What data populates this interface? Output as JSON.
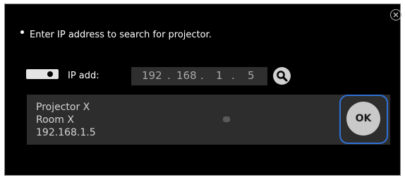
{
  "dialog": {
    "instruction": "Enter IP address to search for projector.",
    "ip_label": "IP add:",
    "ip": {
      "o1": "192",
      "o2": "168",
      "o3": "1",
      "o4": "5",
      "sep": "."
    },
    "result": {
      "name": "Projector X",
      "room": "Room X",
      "address": "192.168.1.5"
    },
    "ok_label": "OK"
  },
  "icons": {
    "close": "close-circle-icon",
    "search": "magnifier-icon",
    "projector": "projector-icon"
  }
}
